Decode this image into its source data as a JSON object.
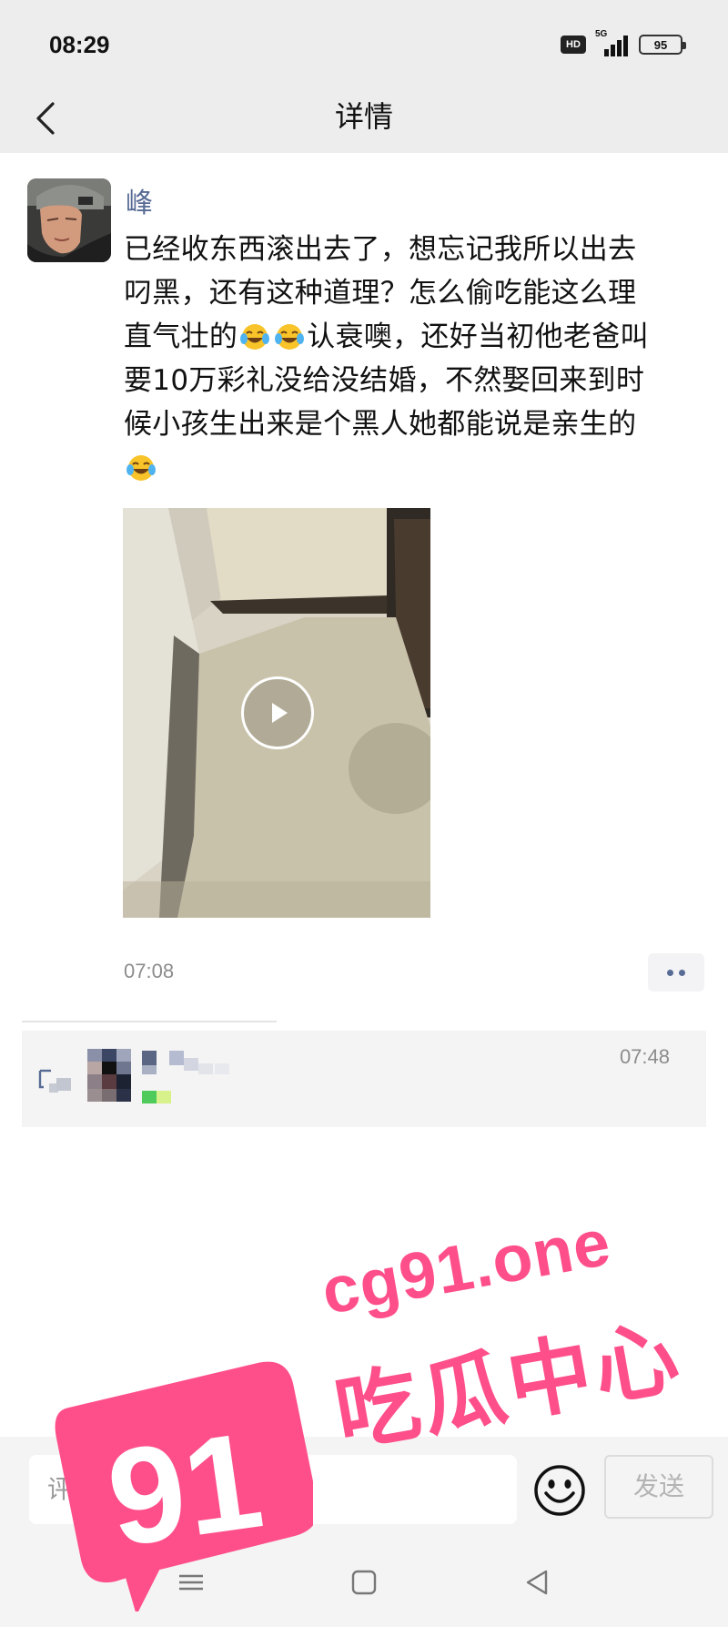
{
  "status_bar": {
    "time": "08:29",
    "hd_label": "HD",
    "network_label": "5G",
    "battery_level": "95"
  },
  "nav": {
    "title": "详情",
    "back_icon": "chevron-left-icon"
  },
  "post": {
    "author": "峰",
    "text_line_1": "已经收东西滚出去了，想忘记我所以出去",
    "text_line_2": "叼黑，还有这种道理？怎么偷吃能这么理",
    "text_line_3a": "直气壮的",
    "text_line_3b": "认衰噢，还好当初他老爸叫",
    "text_line_4": "要10万彩礼没给没结婚，不然娶回来到时",
    "text_line_5": "候小孩生出来是个黑人她都能说是亲生的",
    "emoji_name": "laugh-cry-emoji",
    "time": "07:08",
    "video_icon": "play-icon",
    "more_icon": "more-dots-icon"
  },
  "comment": {
    "time": "07:48",
    "like_icon": "heart-outline-icon"
  },
  "input_bar": {
    "placeholder": "评论",
    "send_label": "发送",
    "emoji_icon": "smiley-icon"
  },
  "system_nav": {
    "menu_icon": "menu-icon",
    "home_icon": "square-home-icon",
    "back_icon": "triangle-back-icon"
  },
  "watermark": {
    "number": "91",
    "site": "cg91.one",
    "name": "吃瓜中心"
  },
  "colors": {
    "link_blue": "#576b95",
    "watermark_pink": "#ff4f8b",
    "bar_gray": "#ededed"
  }
}
